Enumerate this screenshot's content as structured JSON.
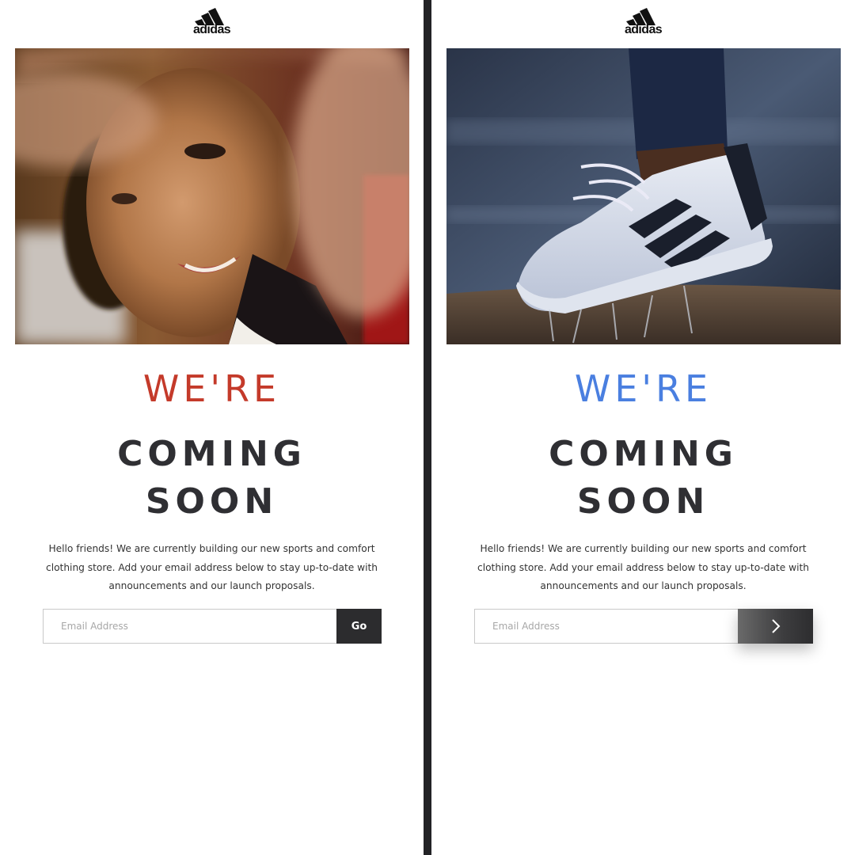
{
  "brand": {
    "logo_icon": "adidas-three-stripes-icon",
    "logo_text": "adidas"
  },
  "panels": [
    {
      "variant": "red",
      "hero_image": "woman-smiling-hand-frame-photo",
      "heading_top": "WE'RE",
      "heading_line1": "COMING",
      "heading_line2": "SOON",
      "accent_color": "#c43a2a",
      "body": "Hello friends! We are currently building our new sports and comfort clothing store. Add your email address below to stay up-to-date with announcements and our launch proposals.",
      "email_placeholder": "Email Address",
      "button_label": "Go"
    },
    {
      "variant": "blue",
      "hero_image": "superstar-sneaker-splash-photo",
      "heading_top": "WE'RE",
      "heading_line1": "COMING",
      "heading_line2": "SOON",
      "accent_color": "#4a7fe0",
      "body": "Hello friends! We are currently building our new sports and comfort clothing store. Add your email address below to stay up-to-date with announcements and our launch proposals.",
      "email_placeholder": "Email Address",
      "button_icon": "chevron-right-icon"
    }
  ]
}
